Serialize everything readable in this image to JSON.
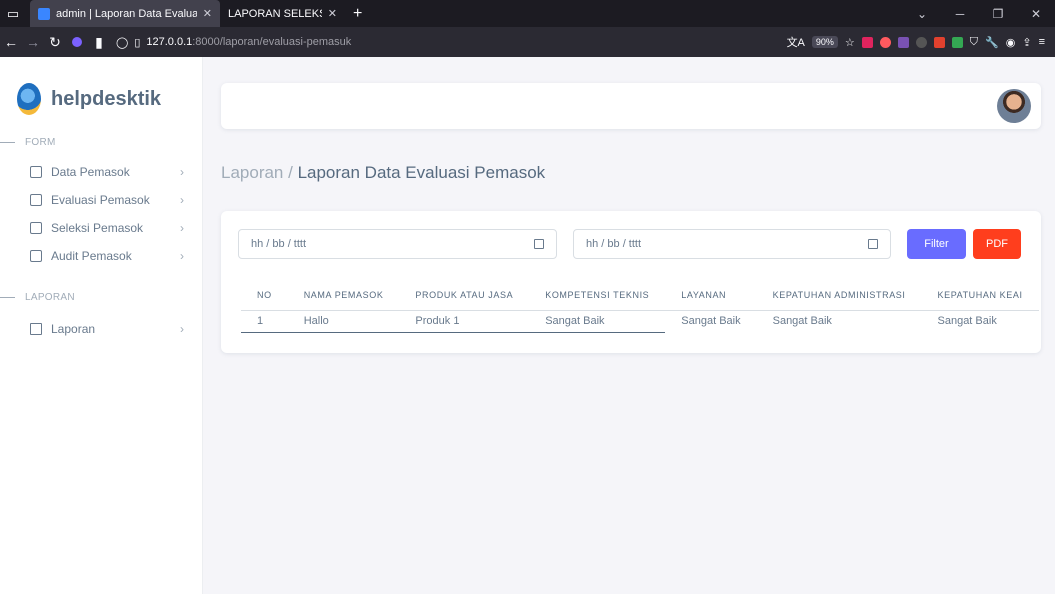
{
  "browser": {
    "tabs": [
      {
        "label": "admin | Laporan Data Evaluasi",
        "active": true
      },
      {
        "label": "LAPORAN SELEKSI PEMASOK",
        "active": false
      }
    ],
    "url_host": "127.0.0.1",
    "url_path": ":8000/laporan/evaluasi-pemasuk",
    "zoom": "90%"
  },
  "brand": {
    "name": "helpdesktik"
  },
  "sidebar": {
    "sections": [
      {
        "title": "FORM",
        "items": [
          {
            "label": "Data Pemasok",
            "icon": "lock-icon"
          },
          {
            "label": "Evaluasi Pemasok",
            "icon": "lock-icon"
          },
          {
            "label": "Seleksi Pemasok",
            "icon": "lock-icon"
          },
          {
            "label": "Audit Pemasok",
            "icon": "lock-icon"
          }
        ]
      },
      {
        "title": "LAPORAN",
        "items": [
          {
            "label": "Laporan",
            "icon": "layout-icon"
          }
        ]
      }
    ]
  },
  "breadcrumb": {
    "parent": "Laporan / ",
    "current": "Laporan Data Evaluasi Pemasok"
  },
  "filter": {
    "start_placeholder": "hh / bb / tttt",
    "end_placeholder": "hh / bb / tttt",
    "filter_label": "Filter",
    "pdf_label": "PDF",
    "filter_color": "#696cff",
    "pdf_color": "#ff3e1d"
  },
  "table": {
    "headers": [
      "NO",
      "NAMA PEMASOK",
      "PRODUK ATAU JASA",
      "KOMPETENSI TEKNIS",
      "LAYANAN",
      "KEPATUHAN ADMINISTRASI",
      "KEPATUHAN KEAI"
    ],
    "rows": [
      [
        "1",
        "Hallo",
        "Produk 1",
        "Sangat Baik",
        "Sangat Baik",
        "Sangat Baik",
        "Sangat Baik"
      ]
    ]
  }
}
